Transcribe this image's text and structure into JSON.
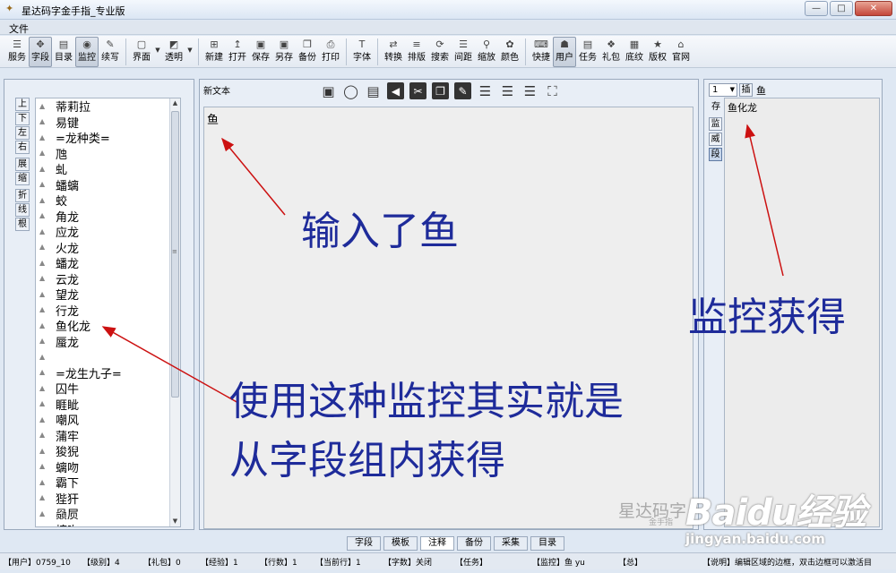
{
  "window": {
    "title": "星达码字金手指_专业版",
    "controls": [
      "—",
      "□",
      "✕"
    ]
  },
  "menu": {
    "items": [
      "文件"
    ]
  },
  "toolbar": {
    "groups": [
      [
        {
          "label": "服务",
          "icon": "rss-icon",
          "glyph": "☰",
          "active": false
        },
        {
          "label": "字段",
          "icon": "field-icon",
          "glyph": "✥",
          "active": true
        },
        {
          "label": "目录",
          "icon": "catalog-icon",
          "glyph": "▤",
          "active": false
        },
        {
          "label": "监控",
          "icon": "monitor-icon",
          "glyph": "◉",
          "active": true
        },
        {
          "label": "续写",
          "icon": "pen-icon",
          "glyph": "✎",
          "active": false
        }
      ],
      [
        {
          "label": "界面",
          "icon": "window-icon",
          "glyph": "▢",
          "active": false,
          "dropdown": true
        },
        {
          "label": "透明",
          "icon": "transparency-icon",
          "glyph": "◩",
          "active": false,
          "dropdown": true
        }
      ],
      [
        {
          "label": "新建",
          "icon": "new-icon",
          "glyph": "⊞",
          "active": false
        },
        {
          "label": "打开",
          "icon": "open-icon",
          "glyph": "↥",
          "active": false
        },
        {
          "label": "保存",
          "icon": "save-icon",
          "glyph": "▣",
          "active": false
        },
        {
          "label": "另存",
          "icon": "save-as-icon",
          "glyph": "▣",
          "active": false
        },
        {
          "label": "备份",
          "icon": "backup-icon",
          "glyph": "❐",
          "active": false
        },
        {
          "label": "打印",
          "icon": "print-icon",
          "glyph": "⎙",
          "active": false
        }
      ],
      [
        {
          "label": "字体",
          "icon": "font-icon",
          "glyph": "T",
          "active": false
        }
      ],
      [
        {
          "label": "转换",
          "icon": "convert-icon",
          "glyph": "⇄",
          "active": false
        },
        {
          "label": "排版",
          "icon": "layout-icon",
          "glyph": "≡",
          "active": false
        },
        {
          "label": "搜索",
          "icon": "search-icon",
          "glyph": "⟳",
          "active": false
        },
        {
          "label": "间距",
          "icon": "spacing-icon",
          "glyph": "☰",
          "active": false
        },
        {
          "label": "缩放",
          "icon": "zoom-icon",
          "glyph": "⚲",
          "active": false
        },
        {
          "label": "颜色",
          "icon": "color-icon",
          "glyph": "✿",
          "active": false
        }
      ],
      [
        {
          "label": "快捷",
          "icon": "shortcut-icon",
          "glyph": "⌨",
          "active": false
        },
        {
          "label": "用户",
          "icon": "user-icon",
          "glyph": "☗",
          "active": true
        },
        {
          "label": "任务",
          "icon": "task-icon",
          "glyph": "▤",
          "active": false
        },
        {
          "label": "礼包",
          "icon": "gift-icon",
          "glyph": "❖",
          "active": false
        },
        {
          "label": "底纹",
          "icon": "texture-icon",
          "glyph": "▦",
          "active": false
        },
        {
          "label": "版权",
          "icon": "copyright-icon",
          "glyph": "★",
          "active": false
        },
        {
          "label": "官网",
          "icon": "home-icon",
          "glyph": "⌂",
          "active": false
        }
      ]
    ]
  },
  "left_panel": {
    "side_buttons": [
      "上",
      "下",
      "左",
      "右",
      "展",
      "缩",
      "折",
      "线",
      "根"
    ],
    "tree_items": [
      "蒂莉拉",
      "易键",
      "=龙种类=",
      "虺",
      "虬",
      "蟠螭",
      "蛟",
      "角龙",
      "应龙",
      "火龙",
      "蟠龙",
      "云龙",
      "望龙",
      "行龙",
      "鱼化龙",
      "蜃龙",
      "",
      "=龙生九子=",
      "囚牛",
      "睚眦",
      "嘲风",
      "蒲牢",
      "狻猊",
      "螭吻",
      "霸下",
      "狴犴",
      "赑屃",
      "螭吻"
    ]
  },
  "center_panel": {
    "doc_name": "新文本",
    "content": "鱼",
    "tools": [
      {
        "name": "save-icon",
        "glyph": "▣"
      },
      {
        "name": "bulb-icon",
        "glyph": "◯"
      },
      {
        "name": "document-icon",
        "glyph": "▤"
      },
      {
        "name": "back-icon",
        "glyph": "◀"
      },
      {
        "name": "scissors-icon",
        "glyph": "✂"
      },
      {
        "name": "copy-icon",
        "glyph": "❐"
      },
      {
        "name": "edit-icon",
        "glyph": "✎"
      },
      {
        "name": "align-left-icon",
        "glyph": "☰"
      },
      {
        "name": "align-center-icon",
        "glyph": "☰"
      },
      {
        "name": "align-right-icon",
        "glyph": "☰"
      },
      {
        "name": "fullscreen-icon",
        "glyph": "⛶"
      }
    ],
    "watermark": "星达码字",
    "watermark_sub": "金手指"
  },
  "right_panel": {
    "select_value": "1",
    "insert_label": "插",
    "query": "鱼",
    "side_label": "存",
    "side_buttons": [
      "监",
      "威",
      "段"
    ],
    "result": "鱼化龙"
  },
  "bottom_tabs": [
    "字段",
    "模板",
    "注释",
    "备份",
    "采集",
    "目录"
  ],
  "bottom_tabs_active": "注释",
  "status": {
    "user": "【用户】0759_10",
    "level": "【级别】4",
    "gift": "【礼包】0",
    "exp": "【经验】1",
    "lines": "【行数】1",
    "current_line": "【当前行】1",
    "word_count": "【字数】关闭",
    "task": "【任务】",
    "monitor": "【监控】鱼 yu",
    "total": "【总】",
    "tip": "【说明】编辑区域的边框，双击边框可以激活目"
  },
  "annotations": {
    "input_note": "输入了鱼",
    "monitor_note": "监控获得",
    "explain_line1": "使用这种监控其实就是",
    "explain_line2": "从字段组内获得"
  },
  "baidu": {
    "logo": "Baidu经验",
    "url": "jingyan.baidu.com"
  }
}
